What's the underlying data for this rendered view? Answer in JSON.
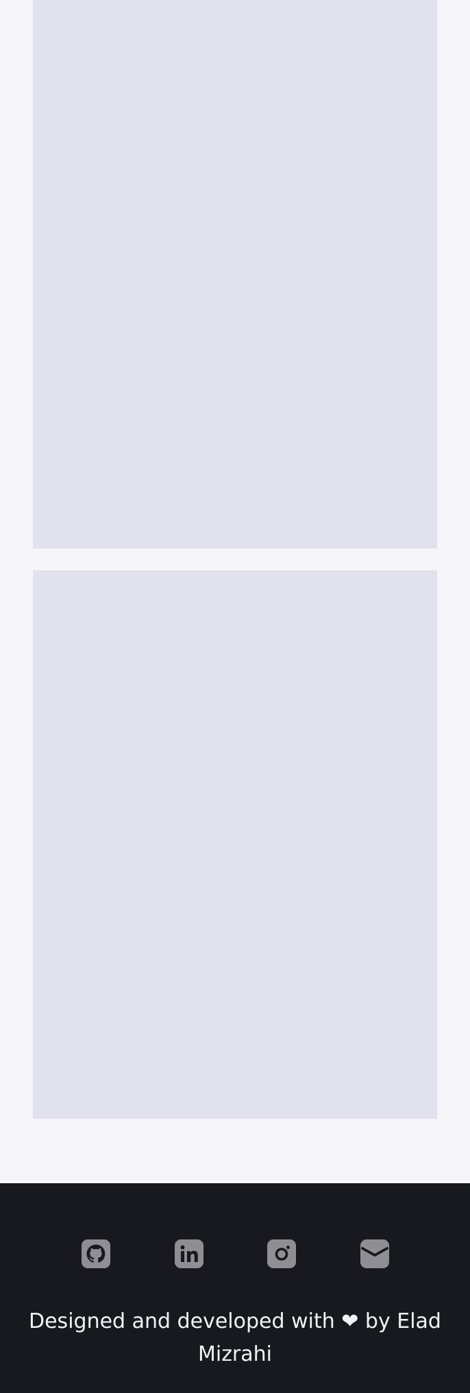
{
  "footer": {
    "social": [
      {
        "name": "github",
        "icon": "github-icon"
      },
      {
        "name": "linkedin",
        "icon": "linkedin-icon"
      },
      {
        "name": "instagram",
        "icon": "instagram-icon"
      },
      {
        "name": "email",
        "icon": "envelope-icon"
      }
    ],
    "credit": "Designed and developed with ❤ by Elad Mizrahi"
  },
  "colors": {
    "page_background": "#f6f6fa",
    "placeholder_card": "#e2e2ee",
    "footer_background": "#18191e",
    "icon": "#8e8e93",
    "footer_text": "#f2f2f6"
  }
}
